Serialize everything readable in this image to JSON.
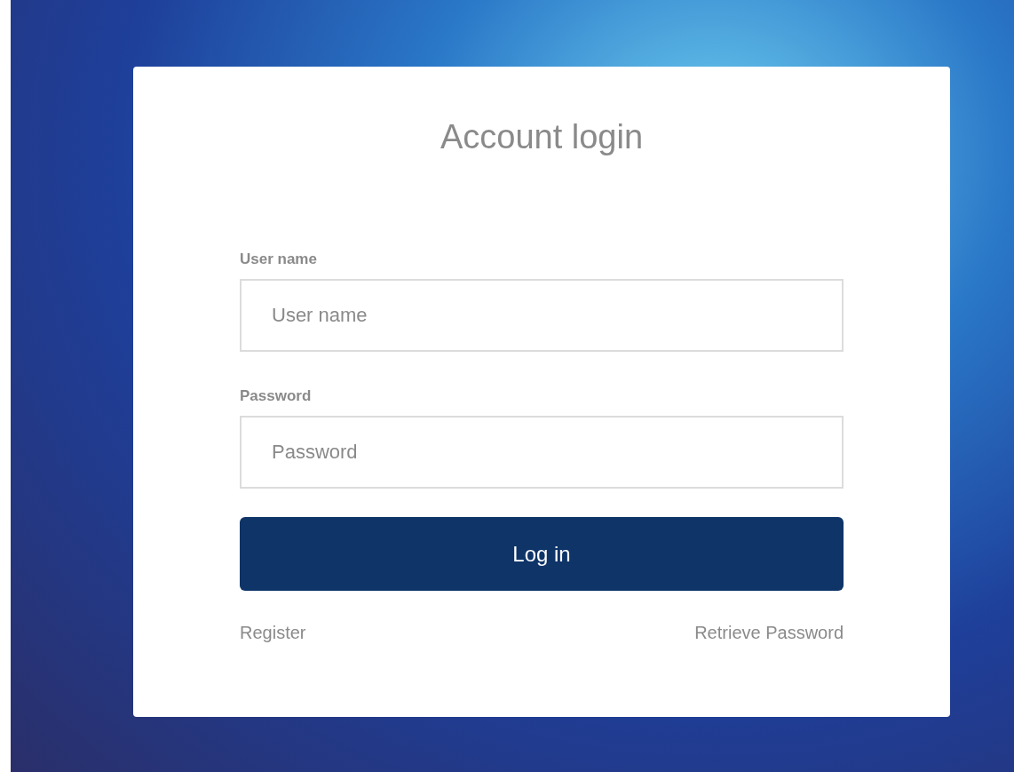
{
  "login_card": {
    "title": "Account login",
    "fields": [
      {
        "label": "User name",
        "placeholder": "User name"
      },
      {
        "label": "Password",
        "placeholder": "Password"
      }
    ],
    "submit_button": "Log in",
    "links": [
      {
        "label": "Register"
      },
      {
        "label": "Retrieve Password"
      }
    ]
  }
}
